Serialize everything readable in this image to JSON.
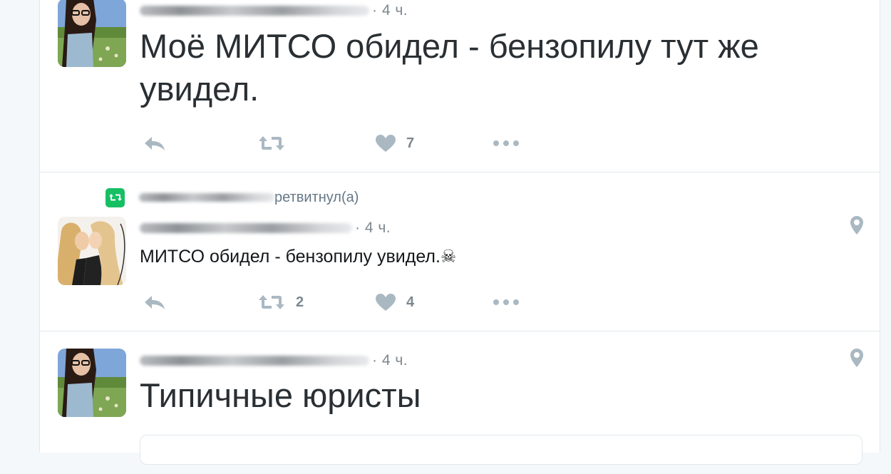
{
  "tweets": [
    {
      "time": "· 4 ч.",
      "text": "Моё МИТСО обидел - бензопилу тут же увидел.",
      "actions": {
        "reply": "",
        "retweet": "",
        "like": "7"
      }
    },
    {
      "retweeted_by": "ретвитнул(а)",
      "time": "· 4 ч.",
      "text": "МИТСО обидел - бензопилу увидел.☠",
      "actions": {
        "reply": "",
        "retweet": "2",
        "like": "4"
      }
    },
    {
      "time": "· 4 ч.",
      "text": "Типичные юристы"
    }
  ],
  "colors": {
    "retweet_green": "#17bf63",
    "icon_gray": "#aab8c2",
    "text_gray": "#7d8890",
    "divider": "#e1e8ed"
  },
  "icons": {
    "reply": "reply-icon",
    "retweet": "retweet-icon",
    "like": "heart-icon",
    "more": "more-icon",
    "location": "location-pin-icon"
  }
}
